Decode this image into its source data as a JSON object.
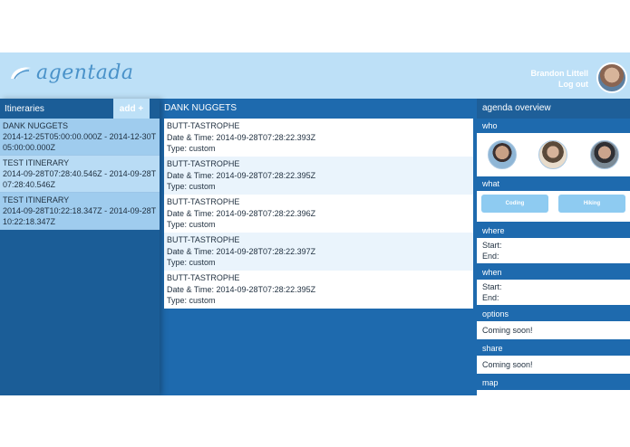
{
  "header": {
    "logo_text": "agentada",
    "user_name": "Brandon Littell",
    "logout_label": "Log out"
  },
  "itineraries": {
    "title": "Itineraries",
    "add_label": "add +",
    "items": [
      {
        "name": "DANK NUGGETS",
        "dates": "2014-12-25T05:00:00.000Z - 2014-12-30T05:00:00.000Z"
      },
      {
        "name": "TEST ITINERARY",
        "dates": "2014-09-28T07:28:40.546Z - 2014-09-28T07:28:40.546Z"
      },
      {
        "name": "TEST ITINERARY",
        "dates": "2014-09-28T10:22:18.347Z - 2014-09-28T10:22:18.347Z"
      }
    ]
  },
  "current": {
    "title": "DANK NUGGETS",
    "events": [
      {
        "name": "BUTT-TASTROPHE",
        "datetime": "Date & Time: 2014-09-28T07:28:22.393Z",
        "type": "Type: custom"
      },
      {
        "name": "BUTT-TASTROPHE",
        "datetime": "Date & Time: 2014-09-28T07:28:22.395Z",
        "type": "Type: custom"
      },
      {
        "name": "BUTT-TASTROPHE",
        "datetime": "Date & Time: 2014-09-28T07:28:22.396Z",
        "type": "Type: custom"
      },
      {
        "name": "BUTT-TASTROPHE",
        "datetime": "Date & Time: 2014-09-28T07:28:22.397Z",
        "type": "Type: custom"
      },
      {
        "name": "BUTT-TASTROPHE",
        "datetime": "Date & Time: 2014-09-28T07:28:22.395Z",
        "type": "Type: custom"
      }
    ]
  },
  "overview": {
    "title": "agenda overview",
    "who_label": "who",
    "what_label": "what",
    "what_tags": [
      "Coding",
      "Hiking"
    ],
    "where_label": "where",
    "where_start": "Start:",
    "where_end": "End:",
    "when_label": "when",
    "when_start": "Start:",
    "when_end": "End:",
    "options_label": "options",
    "options_text": "Coming soon!",
    "share_label": "share",
    "share_text": "Coming soon!",
    "map_label": "map"
  },
  "colors": {
    "header_bg": "#bde0f7",
    "panel_dark": "#1b5d97",
    "panel_main": "#1e6aae",
    "tag_bg": "#8ecbf1"
  }
}
